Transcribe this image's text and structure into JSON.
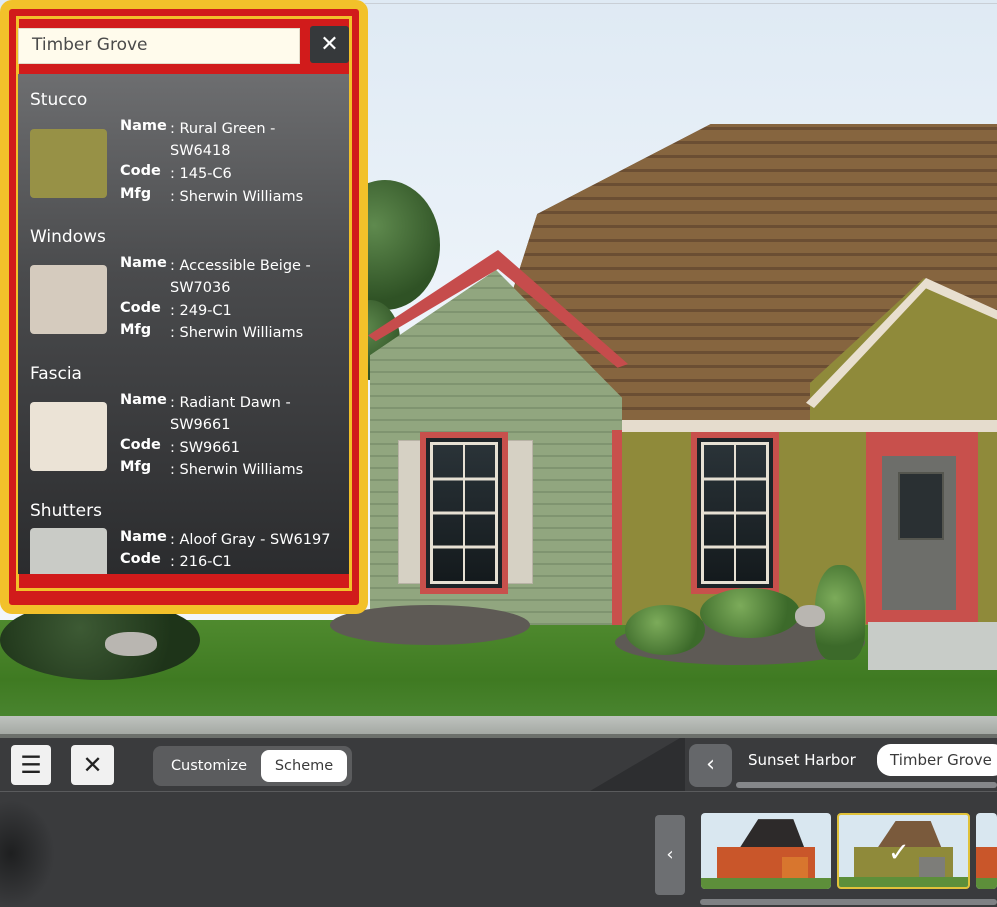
{
  "search": {
    "value": "Timber Grove",
    "close_icon": "close-icon"
  },
  "sections": [
    {
      "title": "Stucco",
      "color": "#979146",
      "name_label": "Name",
      "name_value": ": Rural Green - SW6418",
      "code_label": "Code",
      "code_value": ": 145-C6",
      "mfg_label": "Mfg",
      "mfg_value": ": Sherwin Williams"
    },
    {
      "title": "Windows",
      "color": "#d5cbbe",
      "name_label": "Name",
      "name_value": ": Accessible Beige - SW7036",
      "code_label": "Code",
      "code_value": ": 249-C1",
      "mfg_label": "Mfg",
      "mfg_value": ": Sherwin Williams"
    },
    {
      "title": "Fascia",
      "color": "#ebe3d6",
      "name_label": "Name",
      "name_value": ": Radiant Dawn - SW9661",
      "code_label": "Code",
      "code_value": ": SW9661",
      "mfg_label": "Mfg",
      "mfg_value": ": Sherwin Williams"
    },
    {
      "title": "Shutters",
      "color": "#c9cbc6",
      "name_label": "Name",
      "name_value": ": Aloof Gray - SW6197",
      "code_label": "Code",
      "code_value": ": 216-C1"
    }
  ],
  "toolbar": {
    "menu_icon": "hamburger-menu-icon",
    "close_icon": "close-icon",
    "customize_label": "Customize",
    "scheme_label": "Scheme",
    "active_tab": "Scheme"
  },
  "schemes": {
    "prev_icon": "chevron-left-icon",
    "items": [
      "Sunset Harbor",
      "Timber Grove"
    ],
    "selected": "Timber Grove"
  },
  "thumbnails": {
    "prev_icon": "chevron-left-icon",
    "selected_index": 1,
    "check_icon": "checkmark-icon"
  },
  "colors": {
    "highlight_border": "#f2c12a",
    "highlight_fill": "#d11b1b"
  }
}
